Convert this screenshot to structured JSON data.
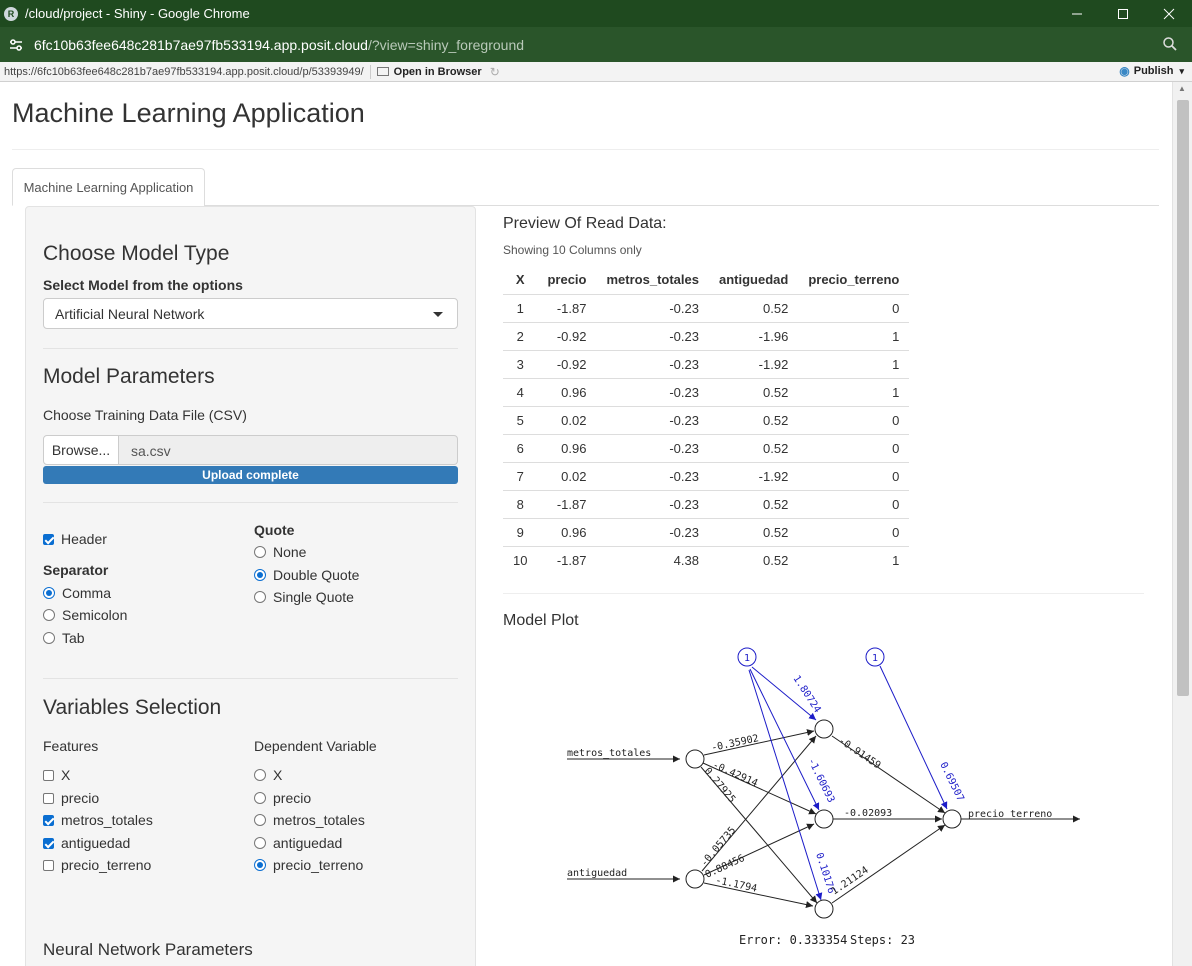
{
  "window": {
    "app_icon_letter": "R",
    "title": "/cloud/project - Shiny - Google Chrome",
    "address_host": "6fc10b63fee648c281b7ae97fb533194.app.posit.cloud",
    "address_path": "/?view=shiny_foreground"
  },
  "extension_bar": {
    "url": "https://6fc10b63fee648c281b7ae97fb533194.app.posit.cloud/p/53393949/",
    "open_in_browser": "Open in Browser",
    "publish": "Publish"
  },
  "page": {
    "title": "Machine Learning Application",
    "tab_label": "Machine Learning Application"
  },
  "sidebar": {
    "model_type_heading": "Choose Model Type",
    "select_model_label": "Select Model from the options",
    "model_selected": "Artificial Neural Network",
    "model_params_heading": "Model Parameters",
    "file_label": "Choose Training Data File (CSV)",
    "browse_label": "Browse...",
    "file_name": "sa.csv",
    "upload_status": "Upload complete",
    "header_label": "Header",
    "separator_label": "Separator",
    "separator_options": [
      "Comma",
      "Semicolon",
      "Tab"
    ],
    "quote_label": "Quote",
    "quote_options": [
      "None",
      "Double Quote",
      "Single Quote"
    ],
    "variables_heading": "Variables Selection",
    "features_label": "Features",
    "features": [
      "X",
      "precio",
      "metros_totales",
      "antiguedad",
      "precio_terreno"
    ],
    "dependent_label": "Dependent Variable",
    "dependent_options": [
      "X",
      "precio",
      "metros_totales",
      "antiguedad",
      "precio_terreno"
    ],
    "nn_params_heading": "Neural Network Parameters"
  },
  "main": {
    "preview_heading": "Preview Of Read Data:",
    "preview_note": "Showing 10 Columns only",
    "table_columns": [
      "X",
      "precio",
      "metros_totales",
      "antiguedad",
      "precio_terreno"
    ],
    "table_rows": [
      [
        "1",
        "-1.87",
        "-0.23",
        "0.52",
        "0"
      ],
      [
        "2",
        "-0.92",
        "-0.23",
        "-1.96",
        "1"
      ],
      [
        "3",
        "-0.92",
        "-0.23",
        "-1.92",
        "1"
      ],
      [
        "4",
        "0.96",
        "-0.23",
        "0.52",
        "1"
      ],
      [
        "5",
        "0.02",
        "-0.23",
        "0.52",
        "0"
      ],
      [
        "6",
        "0.96",
        "-0.23",
        "0.52",
        "0"
      ],
      [
        "7",
        "0.02",
        "-0.23",
        "-1.92",
        "0"
      ],
      [
        "8",
        "-1.87",
        "-0.23",
        "0.52",
        "0"
      ],
      [
        "9",
        "0.96",
        "-0.23",
        "0.52",
        "0"
      ],
      [
        "10",
        "-1.87",
        "4.38",
        "0.52",
        "1"
      ]
    ],
    "model_plot_heading": "Model Plot"
  },
  "nn_plot": {
    "input_labels": [
      "metros_totales",
      "antiguedad"
    ],
    "output_label": "precio_terreno",
    "bias_label": "1",
    "weights_input_hidden": [
      "-0.35902",
      "-0.42914",
      "0.27925",
      "-0.05735",
      "0.88456",
      "-1.1794"
    ],
    "weights_bias_hidden": [
      "1.80724",
      "-1.60693",
      "0.10176"
    ],
    "weights_hidden_output": [
      "-0.91459",
      "-0.02093",
      "1.21124"
    ],
    "weight_bias_output": "0.69507",
    "error_text": "Error: 0.333354",
    "steps_text": "Steps: 23",
    "colors": {
      "black": "#222222",
      "bias": "#1c1cc8"
    }
  }
}
